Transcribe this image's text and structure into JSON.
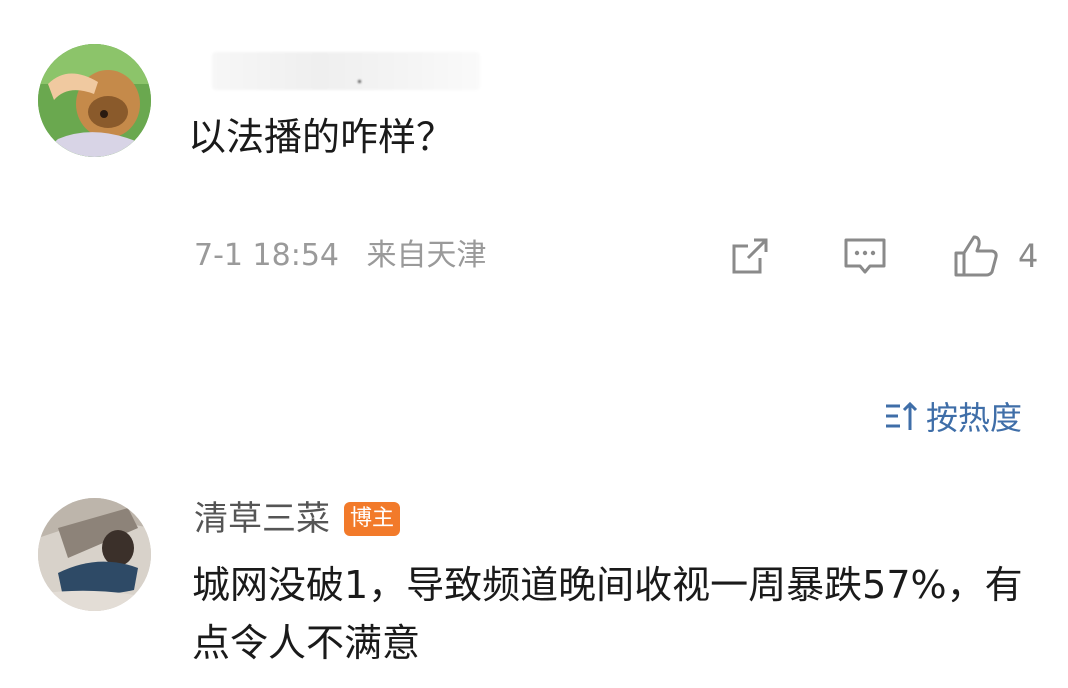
{
  "post1": {
    "comment": "以法播的咋样？",
    "time": "7-1 18:54",
    "location": "来自天津",
    "actions": {
      "share_icon": "share-icon",
      "comment_icon": "comment-icon",
      "like_icon": "thumbs-up-icon",
      "like_count": "4"
    }
  },
  "sort": {
    "label": "按热度",
    "icon": "sort-icon",
    "color": "#3f6ea8"
  },
  "post2": {
    "username": "清草三菜",
    "badge": "博主",
    "badge_color": "#f27a2a",
    "comment": "城网没破1，导致频道晚间收视一周暴跌57%，有点令人不满意"
  }
}
